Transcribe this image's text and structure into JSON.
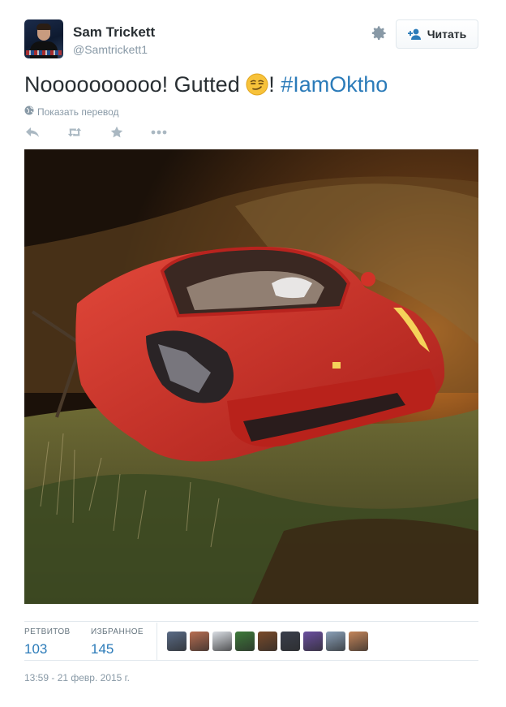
{
  "user": {
    "name": "Sam Trickett",
    "handle": "@Samtrickett1"
  },
  "header": {
    "follow_label": "Читать",
    "settings_icon": "gear-icon",
    "follow_icon": "add-person-icon"
  },
  "tweet": {
    "text_before": "Noooooooooo! Gutted ",
    "emoji_name": "smirking-face-emoji",
    "text_after": "! ",
    "hashtag": "#IamOktho",
    "translate_label": "Показать перевод",
    "translate_icon": "globe-icon"
  },
  "actions": [
    {
      "name": "reply-icon"
    },
    {
      "name": "retweet-icon"
    },
    {
      "name": "favorite-icon"
    },
    {
      "name": "more-icon"
    }
  ],
  "media": {
    "description_icon": "photo"
  },
  "stats": {
    "retweets_label": "РЕТВИТОВ",
    "retweets_count": "103",
    "favorites_label": "ИЗБРАННОЕ",
    "favorites_count": "145"
  },
  "favoriter_avatars": [
    "#5a6b86",
    "#b86e52",
    "#d9dde3",
    "#3e7a3a",
    "#7a4b2a",
    "#3a3f4c",
    "#6b4fa0",
    "#8aa0b8",
    "#c4855a"
  ],
  "timestamp": "13:59 - 21 февр. 2015 г.",
  "colors": {
    "link": "#2b7bb9",
    "muted": "#8899a6",
    "text": "#292f33"
  }
}
